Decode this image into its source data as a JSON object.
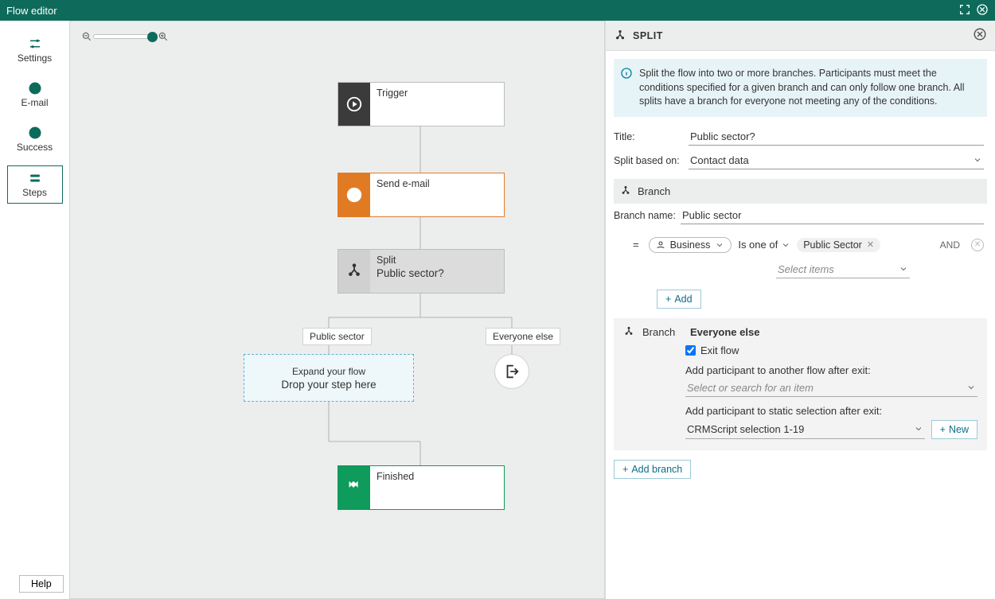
{
  "title": "Flow editor",
  "sidebar": {
    "settings": "Settings",
    "email": "E-mail",
    "success": "Success",
    "steps": "Steps"
  },
  "help": "Help",
  "nodes": {
    "trigger": "Trigger",
    "send_email": "Send e-mail",
    "split_title": "Split",
    "split_sub": "Public sector?",
    "finished": "Finished"
  },
  "branch_left": "Public sector",
  "branch_right": "Everyone else",
  "dropzone": {
    "l1": "Expand your flow",
    "l2": "Drop your step here"
  },
  "panel": {
    "header": "SPLIT",
    "info": "Split the flow into two or more branches. Participants must meet the conditions specified for a given branch and can only follow one branch. All splits have a branch for everyone not meeting any of the conditions.",
    "title_label": "Title:",
    "title_value": "Public sector?",
    "split_label": "Split based on:",
    "split_value": "Contact data",
    "branch_label": "Branch",
    "branch_name_label": "Branch name:",
    "branch_name_value": "Public sector",
    "eq": "=",
    "business": "Business",
    "operator": "Is one of",
    "tag": "Public Sector",
    "and": "AND",
    "select_items": "Select items",
    "add": "Add",
    "else_header": "Everyone else",
    "exit_flow": "Exit flow",
    "add_flow_label": "Add participant to another flow after exit:",
    "add_flow_placeholder": "Select or search for an item",
    "add_sel_label": "Add participant to static selection after exit:",
    "add_sel_value": "CRMScript selection 1-19",
    "new": "New",
    "add_branch": "Add branch"
  }
}
